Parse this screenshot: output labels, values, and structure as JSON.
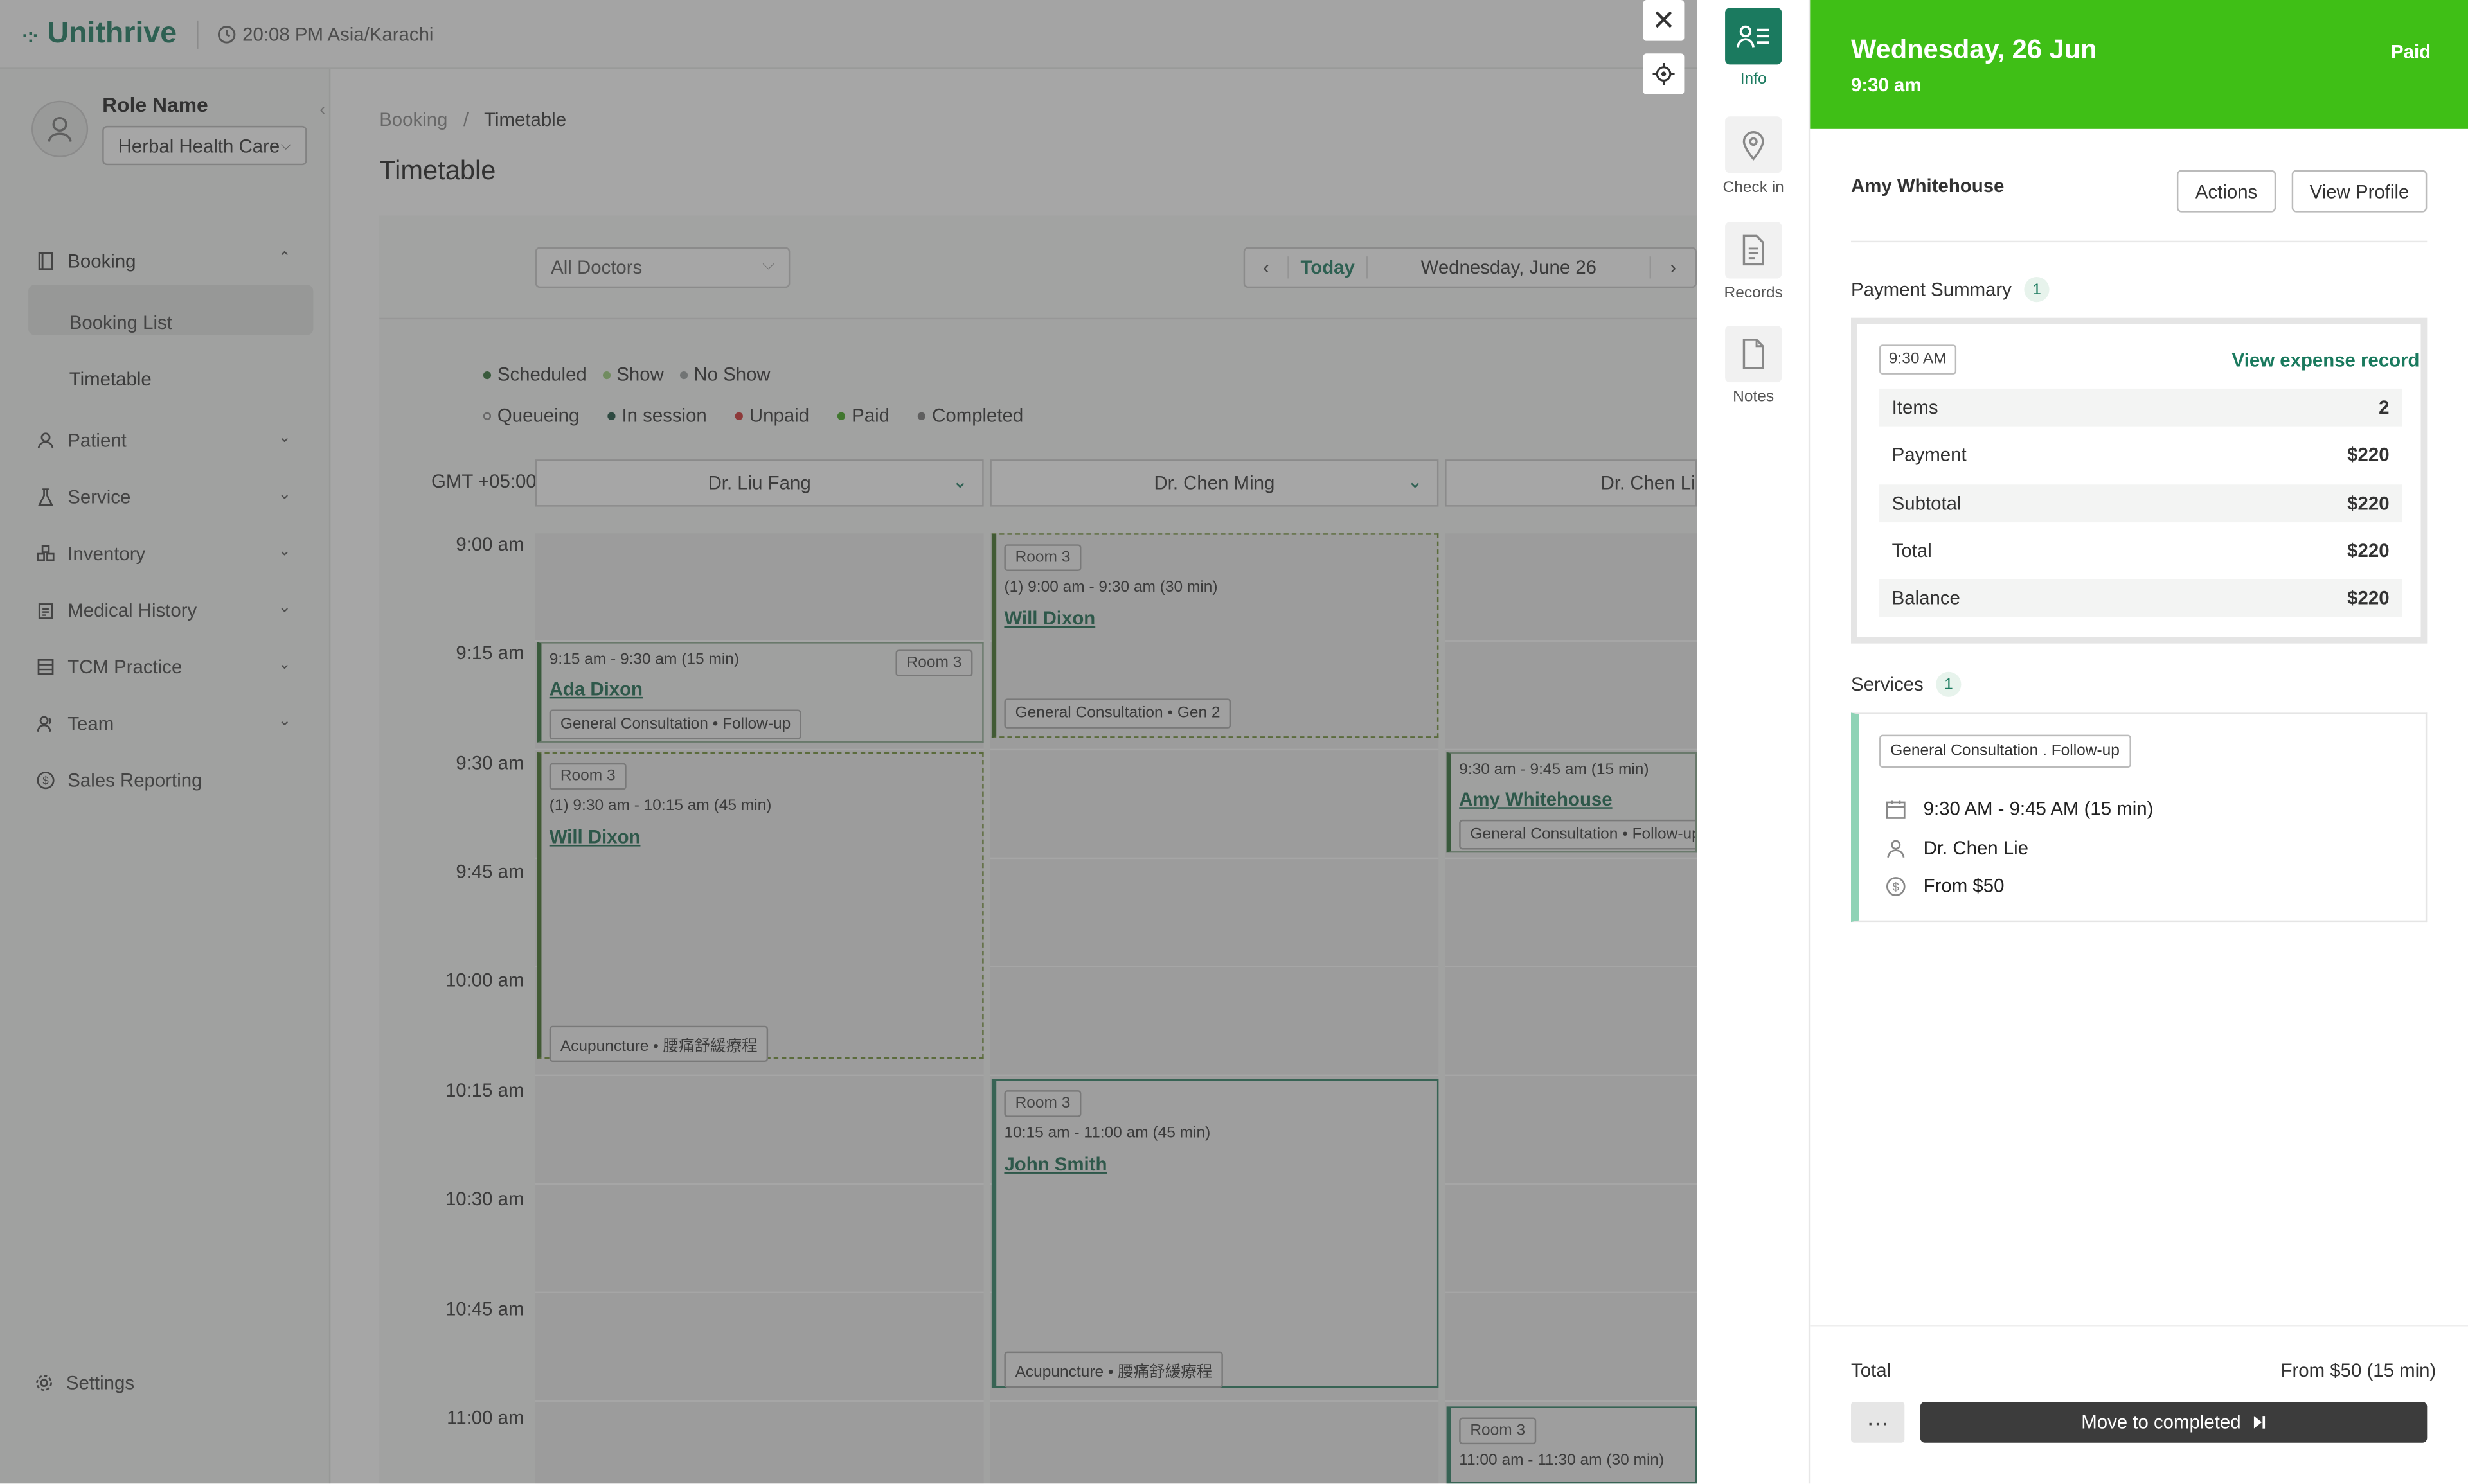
{
  "app": {
    "brand": "Unithrive",
    "clock": "20:08 PM Asia/Karachi",
    "accent_color": "#1a7a5e",
    "paid_color": "#3fbf16"
  },
  "sidebar": {
    "role_name": "Role Name",
    "clinic": "Herbal Health Care",
    "items": [
      {
        "label": "Booking",
        "icon": "book-icon"
      },
      {
        "label": "Patient",
        "icon": "user-icon"
      },
      {
        "label": "Service",
        "icon": "flask-icon"
      },
      {
        "label": "Inventory",
        "icon": "boxes-icon"
      },
      {
        "label": "Medical History",
        "icon": "clipboard-icon"
      },
      {
        "label": "TCM Practice",
        "icon": "table-icon"
      },
      {
        "label": "Team",
        "icon": "team-icon"
      },
      {
        "label": "Sales Reporting",
        "icon": "dollar-icon"
      }
    ],
    "booking_sub": [
      "Booking List",
      "Timetable"
    ],
    "settings": "Settings"
  },
  "main": {
    "breadcrumb": [
      "Booking",
      "Timetable"
    ],
    "title": "Timetable",
    "doctor_filter": "All Doctors",
    "today": "Today",
    "date": "Wednesday, June 26",
    "legend_row1": [
      {
        "label": "Scheduled",
        "color": "#2f6e35"
      },
      {
        "label": "Show",
        "color": "#9acd7a"
      },
      {
        "label": "No Show",
        "color": "#9aa0a0"
      }
    ],
    "legend_row2": [
      {
        "label": "Queueing",
        "color": "#ffffff"
      },
      {
        "label": "In session",
        "color": "#1a4f3e"
      },
      {
        "label": "Unpaid",
        "color": "#d03030"
      },
      {
        "label": "Paid",
        "color": "#3fa51b"
      },
      {
        "label": "Completed",
        "color": "#777777"
      }
    ],
    "timezone": "GMT +05:00",
    "doctors": [
      "Dr. Liu Fang",
      "Dr. Chen Ming",
      "Dr. Chen Lie"
    ],
    "times": [
      "9:00 am",
      "9:15 am",
      "9:30 am",
      "9:45 am",
      "10:00 am",
      "10:15 am",
      "10:30 am",
      "10:45 am",
      "11:00 am"
    ],
    "appointments": [
      {
        "room": "Room 3",
        "time": "9:15 am - 9:30 am (15 min)",
        "patient": "Ada Dixon",
        "tag": "General Consultation  •  Follow-up"
      },
      {
        "room": "Room 3",
        "time": "(1) 9:30 am - 10:15 am (45 min)",
        "patient": "Will Dixon",
        "tag": "Acupuncture  •  腰痛舒緩療程"
      },
      {
        "room": "Room 3",
        "time": "(1) 9:00 am - 9:30 am (30 min)",
        "patient": "Will Dixon",
        "tag": "General Consultation  •  Gen 2"
      },
      {
        "room": "Room 3",
        "time": "10:15 am - 11:00 am (45 min)",
        "patient": "John Smith",
        "tag": "Acupuncture  •  腰痛舒緩療程"
      },
      {
        "room": "",
        "time": "9:30 am - 9:45 am (15 min)",
        "patient": "Amy Whitehouse",
        "tag": "General Consultation  •  Follow-up"
      },
      {
        "room": "Room 3",
        "time": "11:00 am - 11:30 am (30 min)",
        "patient": "",
        "tag": ""
      }
    ]
  },
  "rail": [
    {
      "label": "Info",
      "icon": "info-card-icon"
    },
    {
      "label": "Check in",
      "icon": "location-pin-icon"
    },
    {
      "label": "Records",
      "icon": "document-icon"
    },
    {
      "label": "Notes",
      "icon": "note-icon"
    }
  ],
  "detail": {
    "date": "Wednesday, 26 Jun",
    "time": "9:30 am",
    "status": "Paid",
    "patient": "Amy Whitehouse",
    "actions": "Actions",
    "view_profile": "View Profile",
    "payment_title": "Payment Summary",
    "payment_count": "1",
    "payment_time": "9:30 AM",
    "view_expense": "View expense record",
    "payment_rows": [
      {
        "label": "Items",
        "value": "2"
      },
      {
        "label": "Payment",
        "value": "$220"
      },
      {
        "label": "Subtotal",
        "value": "$220"
      },
      {
        "label": "Total",
        "value": "$220"
      },
      {
        "label": "Balance",
        "value": "$220"
      }
    ],
    "services_title": "Services",
    "services_count": "1",
    "service_tag": "General Consultation . Follow-up",
    "service_time": "9:30 AM - 9:45 AM (15 min)",
    "service_doctor": "Dr. Chen Lie",
    "service_price": "From $50",
    "total_label": "Total",
    "total_value": "From $50 (15 min)",
    "more": "···",
    "complete": "Move to completed"
  }
}
